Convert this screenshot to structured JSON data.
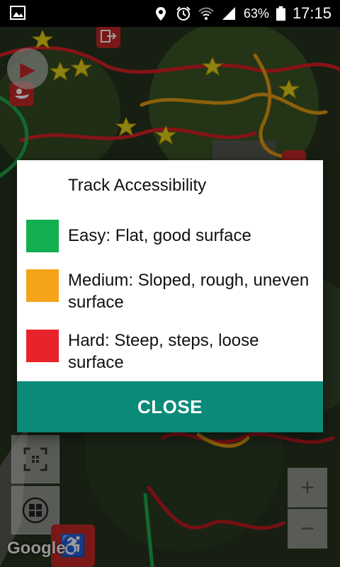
{
  "status_bar": {
    "battery_percent": "63%",
    "time": "17:15",
    "icons": [
      "image-icon",
      "location-icon",
      "alarm-icon",
      "wifi-icon",
      "signal-icon",
      "battery-icon"
    ]
  },
  "map": {
    "attribution": "Google",
    "zoom_in_label": "+",
    "zoom_out_label": "−",
    "track_colors": {
      "easy": "#1fa84a",
      "medium": "#e39b12",
      "hard": "#d81f26"
    }
  },
  "dialog": {
    "title": "Track Accessibility",
    "legend": [
      {
        "label": "Easy: Flat, good surface",
        "color": "#12b050"
      },
      {
        "label": "Medium: Sloped, rough, uneven surface",
        "color": "#f5a318"
      },
      {
        "label": "Hard: Steep, steps, loose surface",
        "color": "#e8232a"
      }
    ],
    "close_label": "CLOSE"
  }
}
